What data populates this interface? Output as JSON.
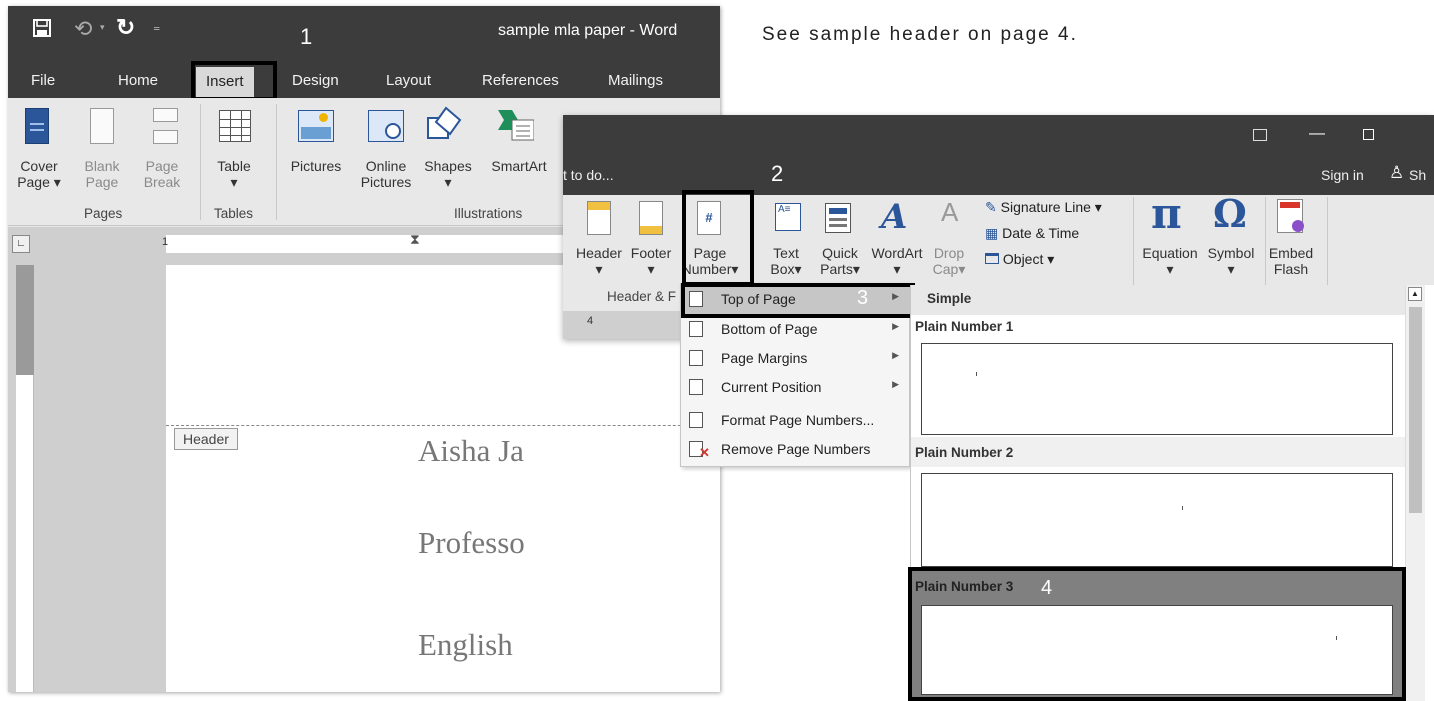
{
  "instruction": "See sample header on page 4.",
  "step_numbers": [
    "1",
    "2",
    "3",
    "4"
  ],
  "win1": {
    "title": "sample mla paper - Word",
    "qat_icons": [
      "save-icon",
      "undo-icon",
      "redo-icon",
      "customize-qat-icon"
    ],
    "tabs": [
      "File",
      "Home",
      "Insert",
      "Design",
      "Layout",
      "References",
      "Mailings"
    ],
    "selected_tab": "Insert",
    "ribbon": {
      "cover_page": "Cover",
      "cover_page2": "Page",
      "blank_page": "Blank",
      "blank_page2": "Page",
      "page_break": "Page",
      "page_break2": "Break",
      "table": "Table",
      "pictures": "Pictures",
      "online_pictures": "Online",
      "online_pictures2": "Pictures",
      "shapes": "Shapes",
      "smartart": "SmartArt",
      "group_pages": "Pages",
      "group_tables": "Tables",
      "group_illustrations": "Illustrations"
    },
    "ruler_number": "1",
    "header_tag": "Header",
    "doc_lines": [
      "Aisha Ja",
      "Professo",
      "English"
    ]
  },
  "win2": {
    "tell_me": "t to do...",
    "sign_in": "Sign in",
    "share": "Sh",
    "ribbon": {
      "header": "Header",
      "footer": "Footer",
      "page_number": "Page",
      "page_number2": "Number",
      "group_header_footer": "Header & F",
      "text_box": "Text",
      "text_box2": "Box",
      "quick_parts": "Quick",
      "quick_parts2": "Parts",
      "wordart": "WordArt",
      "drop_cap": "Drop",
      "drop_cap2": "Cap",
      "signature_line": "Signature Line",
      "date_time": "Date & Time",
      "object": "Object",
      "equation": "Equation",
      "symbol": "Symbol",
      "embed_flash": "Embed",
      "embed_flash2": "Flash"
    },
    "ruler_number": "4"
  },
  "menu": {
    "items": [
      "Top of Page",
      "Bottom of Page",
      "Page Margins",
      "Current Position",
      "Format Page Numbers...",
      "Remove Page Numbers"
    ],
    "highlighted": "Top of Page"
  },
  "gallery": {
    "section": "Simple",
    "items": [
      "Plain Number 1",
      "Plain Number 2",
      "Plain Number 3"
    ],
    "selected": "Plain Number 3"
  },
  "colors": {
    "titlebar": "#3c3c3c",
    "ribbon": "#e8e8e8",
    "highlight_box": "#000000",
    "word_blue": "#2b579a"
  }
}
